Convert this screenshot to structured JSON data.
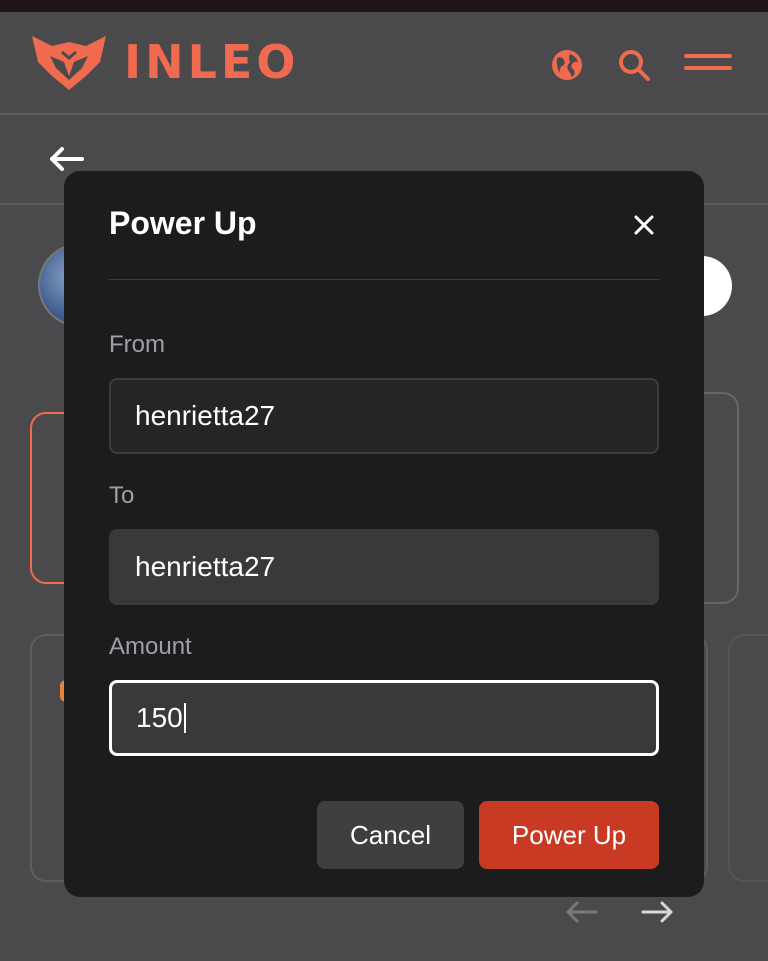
{
  "app": {
    "brand": "INLEO",
    "colors": {
      "accent": "#f06a4f",
      "primary_button": "#c93a24",
      "modal_bg": "#1c1c1e",
      "page_bg": "#4a4a4c"
    }
  },
  "header": {
    "icons": [
      "globe-icon",
      "search-icon",
      "menu-icon"
    ]
  },
  "modal": {
    "title": "Power Up",
    "fields": {
      "from": {
        "label": "From",
        "value": "henrietta27"
      },
      "to": {
        "label": "To",
        "value": "henrietta27"
      },
      "amount": {
        "label": "Amount",
        "value": "150"
      }
    },
    "buttons": {
      "cancel": "Cancel",
      "submit": "Power Up"
    }
  }
}
